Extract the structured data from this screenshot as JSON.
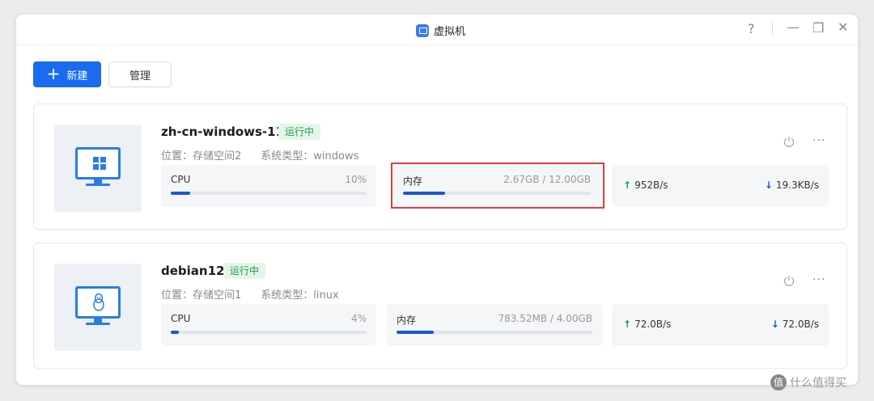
{
  "window": {
    "title": "虚拟机",
    "icon": "virtual-machine-icon"
  },
  "toolbar": {
    "new_label": "新建",
    "manage_label": "管理"
  },
  "vms": [
    {
      "name": "zh-cn-windows-11",
      "status": "运行中",
      "location": "位置：存储空间2",
      "os_type": "系统类型：windows",
      "os_icon": "windows-icon",
      "cpu_label": "CPU",
      "cpu_value": "10%",
      "cpu_fraction": 0.1,
      "mem_label": "内存",
      "mem_value": "2.67GB / 12.00GB",
      "mem_fraction": 0.2225,
      "net_up": "952B/s",
      "net_down": "19.3KB/s"
    },
    {
      "name": "debian12",
      "status": "运行中",
      "location": "位置：存储空间1",
      "os_type": "系统类型：linux",
      "os_icon": "linux-tux-icon",
      "cpu_label": "CPU",
      "cpu_value": "4%",
      "cpu_fraction": 0.04,
      "mem_label": "内存",
      "mem_value": "783.52MB / 4.00GB",
      "mem_fraction": 0.19,
      "net_up": "72.0B/s",
      "net_down": "72.0B/s"
    }
  ],
  "colors": {
    "accent": "#1a6bf0",
    "running_green": "#1aa048",
    "highlight_red": "#e33b3b"
  },
  "watermark": "什么值得买"
}
